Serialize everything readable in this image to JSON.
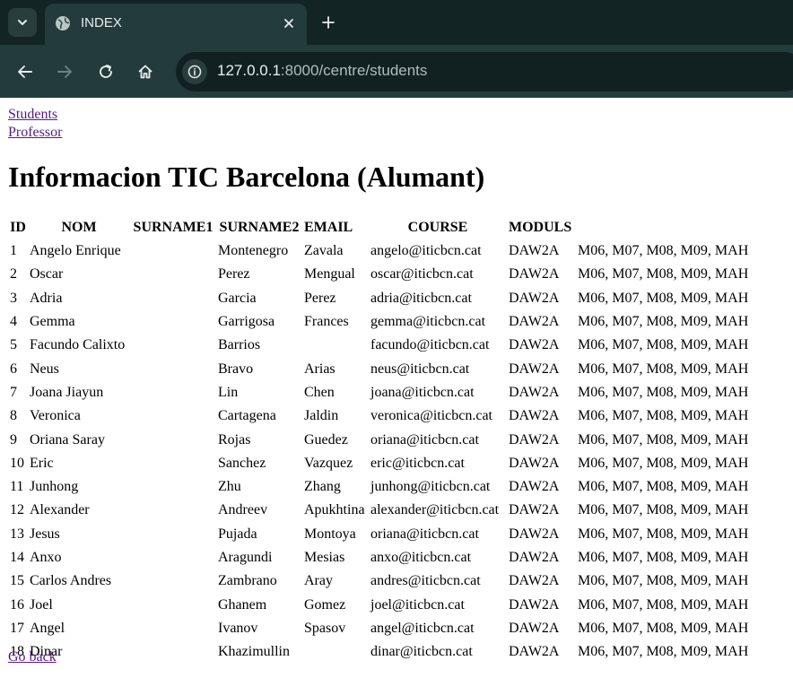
{
  "browser": {
    "tab_title": "INDEX",
    "url_host": "127.0.0.1",
    "url_rest": ":8000/centre/students"
  },
  "page": {
    "links": [
      "Students",
      "Professor"
    ],
    "heading": "Informacion TIC Barcelona (Alumant)",
    "back_link": "Go back"
  },
  "table": {
    "headers": [
      "ID",
      "NOM",
      "SURNAME1",
      "SURNAME2",
      "EMAIL",
      "COURSE",
      "MODULS"
    ],
    "rows": [
      [
        "1",
        "Angelo Enrique",
        "Montenegro",
        "Zavala",
        "angelo@iticbcn.cat",
        "DAW2A",
        "M06, M07, M08, M09, MAH"
      ],
      [
        "2",
        "Oscar",
        "Perez",
        "Mengual",
        "oscar@iticbcn.cat",
        "DAW2A",
        "M06, M07, M08, M09, MAH"
      ],
      [
        "3",
        "Adria",
        "Garcia",
        "Perez",
        "adria@iticbcn.cat",
        "DAW2A",
        "M06, M07, M08, M09, MAH"
      ],
      [
        "4",
        "Gemma",
        "Garrigosa",
        "Frances",
        "gemma@iticbcn.cat",
        "DAW2A",
        "M06, M07, M08, M09, MAH"
      ],
      [
        "5",
        "Facundo Calixto",
        "Barrios",
        "",
        "facundo@iticbcn.cat",
        "DAW2A",
        "M06, M07, M08, M09, MAH"
      ],
      [
        "6",
        "Neus",
        "Bravo",
        "Arias",
        "neus@iticbcn.cat",
        "DAW2A",
        "M06, M07, M08, M09, MAH"
      ],
      [
        "7",
        "Joana Jiayun",
        "Lin",
        "Chen",
        "joana@iticbcn.cat",
        "DAW2A",
        "M06, M07, M08, M09, MAH"
      ],
      [
        "8",
        "Veronica",
        "Cartagena",
        "Jaldin",
        "veronica@iticbcn.cat",
        "DAW2A",
        "M06, M07, M08, M09, MAH"
      ],
      [
        "9",
        "Oriana Saray",
        "Rojas",
        "Guedez",
        "oriana@iticbcn.cat",
        "DAW2A",
        "M06, M07, M08, M09, MAH"
      ],
      [
        "10",
        "Eric",
        "Sanchez",
        "Vazquez",
        "eric@iticbcn.cat",
        "DAW2A",
        "M06, M07, M08, M09, MAH"
      ],
      [
        "11",
        "Junhong",
        "Zhu",
        "Zhang",
        "junhong@iticbcn.cat",
        "DAW2A",
        "M06, M07, M08, M09, MAH"
      ],
      [
        "12",
        "Alexander",
        "Andreev",
        "Apukhtina",
        "alexander@iticbcn.cat",
        "DAW2A",
        "M06, M07, M08, M09, MAH"
      ],
      [
        "13",
        "Jesus",
        "Pujada",
        "Montoya",
        "oriana@iticbcn.cat",
        "DAW2A",
        "M06, M07, M08, M09, MAH"
      ],
      [
        "14",
        "Anxo",
        "Aragundi",
        "Mesias",
        "anxo@iticbcn.cat",
        "DAW2A",
        "M06, M07, M08, M09, MAH"
      ],
      [
        "15",
        "Carlos Andres",
        "Zambrano",
        "Aray",
        "andres@iticbcn.cat",
        "DAW2A",
        "M06, M07, M08, M09, MAH"
      ],
      [
        "16",
        "Joel",
        "Ghanem",
        "Gomez",
        "joel@iticbcn.cat",
        "DAW2A",
        "M06, M07, M08, M09, MAH"
      ],
      [
        "17",
        "Angel",
        "Ivanov",
        "Spasov",
        "angel@iticbcn.cat",
        "DAW2A",
        "M06, M07, M08, M09, MAH"
      ],
      [
        "18",
        "Dinar",
        "Khazimullin",
        "",
        "dinar@iticbcn.cat",
        "DAW2A",
        "M06, M07, M08, M09, MAH"
      ]
    ]
  },
  "icons": {
    "tab_search": "chevron-down-icon",
    "tab_favicon": "globe-icon",
    "tab_close": "close-icon",
    "new_tab": "plus-icon",
    "back": "arrow-left-icon",
    "forward": "arrow-right-icon",
    "reload": "reload-icon",
    "home": "home-icon",
    "site_info": "info-icon"
  },
  "colors": {
    "tabstrip": "#122424",
    "toolbar": "#233b3b",
    "omnibox": "#112121",
    "link_visited": "#551a8b"
  }
}
